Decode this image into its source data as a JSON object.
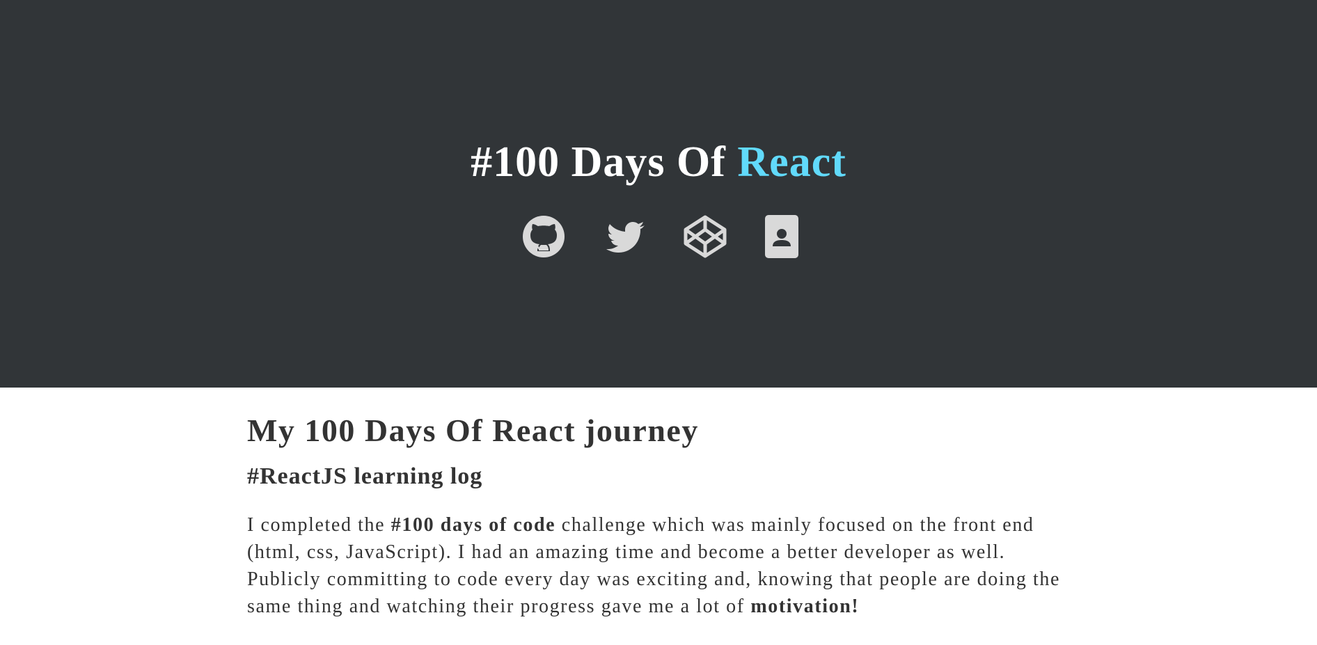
{
  "hero": {
    "title_prefix": "#100 Days Of ",
    "title_accent": "React",
    "background": "#313538",
    "accent_color": "#61dafb",
    "icon_color": "#d9d9d9",
    "social_links": [
      {
        "icon": "github-icon"
      },
      {
        "icon": "twitter-icon"
      },
      {
        "icon": "codepen-icon"
      },
      {
        "icon": "contact-card-icon"
      }
    ]
  },
  "main": {
    "heading": "My 100 Days Of React journey",
    "subheading": "#ReactJS learning log",
    "intro": {
      "part1": "I completed the ",
      "bold1": "#100 days of code",
      "part2": " challenge which was mainly focused on the front end (html, css, JavaScript). I had an amazing time and become a better developer as well. Publicly committing to code every day was exciting and, knowing that people are doing the same thing and watching their progress gave me a lot of ",
      "bold2": "motivation!"
    }
  }
}
